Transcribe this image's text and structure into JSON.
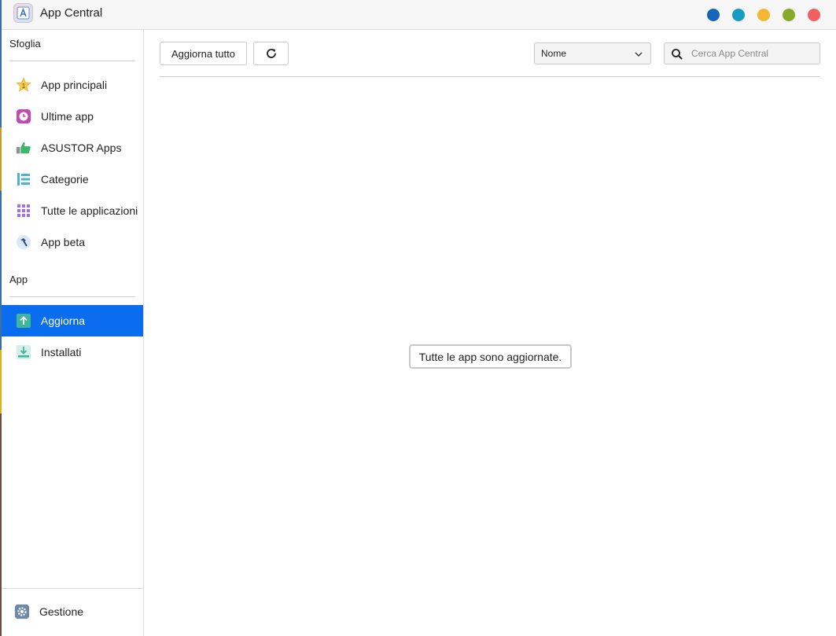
{
  "window": {
    "title": "App Central",
    "icon": "app-central-icon",
    "controls": [
      {
        "name": "window-dot-blue",
        "color": "#1565b8"
      },
      {
        "name": "window-dot-teal",
        "color": "#169bc2"
      },
      {
        "name": "window-dot-yellow",
        "color": "#f5b731"
      },
      {
        "name": "window-dot-green",
        "color": "#88a928"
      },
      {
        "name": "window-dot-red",
        "color": "#f0605e"
      }
    ]
  },
  "sidebar": {
    "browse_label": "Sfoglia",
    "browse_items": [
      {
        "label": "App principali",
        "icon": "star-icon"
      },
      {
        "label": "Ultime app",
        "icon": "clock-icon"
      },
      {
        "label": "ASUSTOR Apps",
        "icon": "thumbs-up-icon"
      },
      {
        "label": "Categorie",
        "icon": "list-icon"
      },
      {
        "label": "Tutte le applicazioni",
        "icon": "grid-icon"
      },
      {
        "label": "App beta",
        "icon": "hammer-icon"
      }
    ],
    "app_label": "App",
    "app_items": [
      {
        "label": "Aggiorna",
        "icon": "upload-icon",
        "active": true
      },
      {
        "label": "Installati",
        "icon": "download-icon",
        "active": false
      }
    ],
    "footer": {
      "label": "Gestione",
      "icon": "gear-icon"
    }
  },
  "toolbar": {
    "update_all_label": "Aggiorna tutto",
    "refresh_icon": "refresh-icon",
    "sort_value": "Nome",
    "search_placeholder": "Cerca App Central"
  },
  "content": {
    "empty_message": "Tutte le app sono aggiornate."
  },
  "colors": {
    "accent": "#0a6df0"
  }
}
